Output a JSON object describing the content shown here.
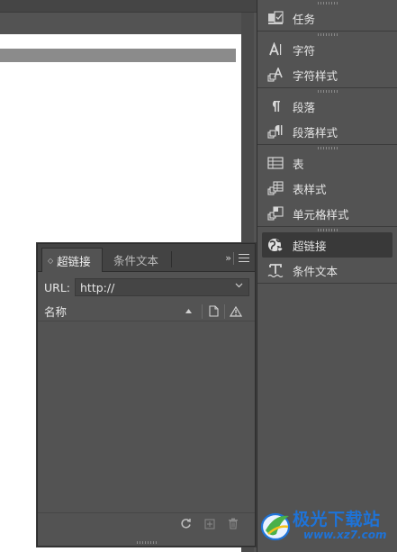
{
  "dock": {
    "groups": [
      {
        "items": [
          {
            "label": "任务",
            "icon": "task-icon"
          }
        ]
      },
      {
        "items": [
          {
            "label": "字符",
            "icon": "character-icon"
          },
          {
            "label": "字符样式",
            "icon": "character-style-icon"
          }
        ]
      },
      {
        "items": [
          {
            "label": "段落",
            "icon": "paragraph-icon"
          },
          {
            "label": "段落样式",
            "icon": "paragraph-style-icon"
          }
        ]
      },
      {
        "items": [
          {
            "label": "表",
            "icon": "table-icon"
          },
          {
            "label": "表样式",
            "icon": "table-style-icon"
          },
          {
            "label": "单元格样式",
            "icon": "cell-style-icon"
          }
        ]
      },
      {
        "items": [
          {
            "label": "超链接",
            "icon": "hyperlink-icon",
            "active": true
          },
          {
            "label": "条件文本",
            "icon": "conditional-text-icon"
          }
        ]
      }
    ]
  },
  "hyperlinks_panel": {
    "tabs": [
      {
        "label": "超链接",
        "active": true
      },
      {
        "label": "条件文本",
        "active": false
      }
    ],
    "collapse_glyph": "››",
    "url_label": "URL:",
    "url_value": "http://",
    "column_name": "名称",
    "items": []
  },
  "watermark": {
    "text": "极光下载站",
    "url": "www.xz7.com"
  },
  "colors": {
    "panel_bg": "#535353",
    "tab_bar_bg": "#434343",
    "active_item_bg": "#393939",
    "document_page": "#ffffff",
    "watermark_blue": "#1e73d8"
  }
}
